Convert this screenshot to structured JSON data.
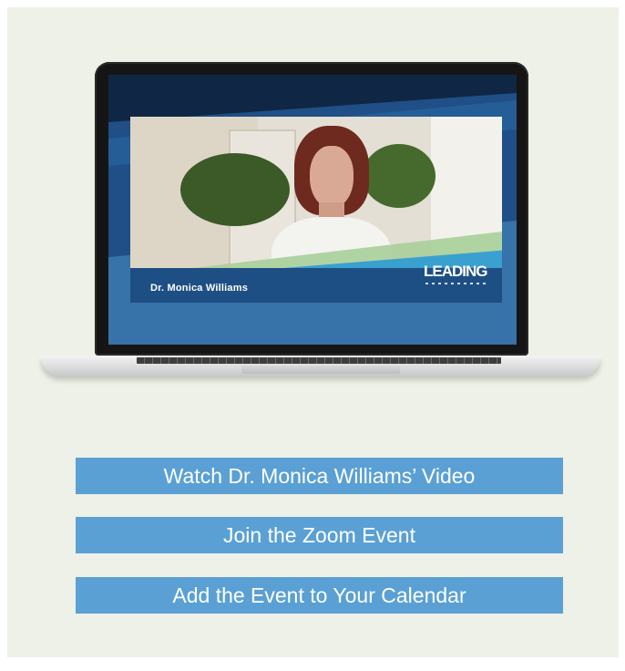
{
  "video_preview": {
    "speaker_caption": "Dr. Monica Williams",
    "logo_text": "LEADING"
  },
  "actions": {
    "watch_video_label": "Watch Dr. Monica Williams’ Video",
    "join_zoom_label": "Join the Zoom Event",
    "add_calendar_label": "Add the Event to Your Calendar"
  },
  "colors": {
    "panel_background": "#edf1e7",
    "button_background": "#5aa0d4",
    "button_text": "#ffffff",
    "screen_blue": "#1e4f84",
    "accent_green": "#a9cf9a"
  }
}
